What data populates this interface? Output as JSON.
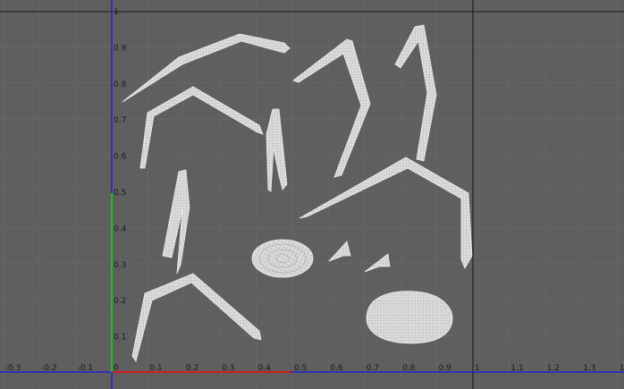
{
  "viewport": {
    "label": "UV Editor viewport"
  },
  "axis": {
    "x_ticks": [
      "-0.3",
      "-0.2",
      "-0.1",
      "0",
      "0.1",
      "0.2",
      "0.3",
      "0.4",
      "0.5",
      "0.6",
      "0.7",
      "0.8",
      "0.9",
      "1",
      "1.1",
      "1.2",
      "1.3",
      "1.4"
    ],
    "y_ticks": [
      "0.1",
      "0.2",
      "0.3",
      "0.4",
      "0.5",
      "0.6",
      "0.7",
      "0.8",
      "0.9",
      "1"
    ]
  },
  "colors": {
    "background": "#5f5f5f",
    "grid": "#6f6f6f",
    "unit_frame": "#111111",
    "u_axis": "#d41a1a",
    "v_axis": "#1fbf1f",
    "axis_blue": "#2020d0",
    "uv_shell": "#d9d9d9"
  },
  "shells": [
    "leg-shell-top-left",
    "leg-shell-mid-left",
    "leg-shell-center-thin",
    "leg-shell-top-right-a",
    "leg-shell-top-right-b",
    "leg-shell-large-right",
    "leg-shell-small-left",
    "leg-shell-bottom-left",
    "head-shell",
    "fang-shell-a",
    "fang-shell-b",
    "body-shell"
  ]
}
